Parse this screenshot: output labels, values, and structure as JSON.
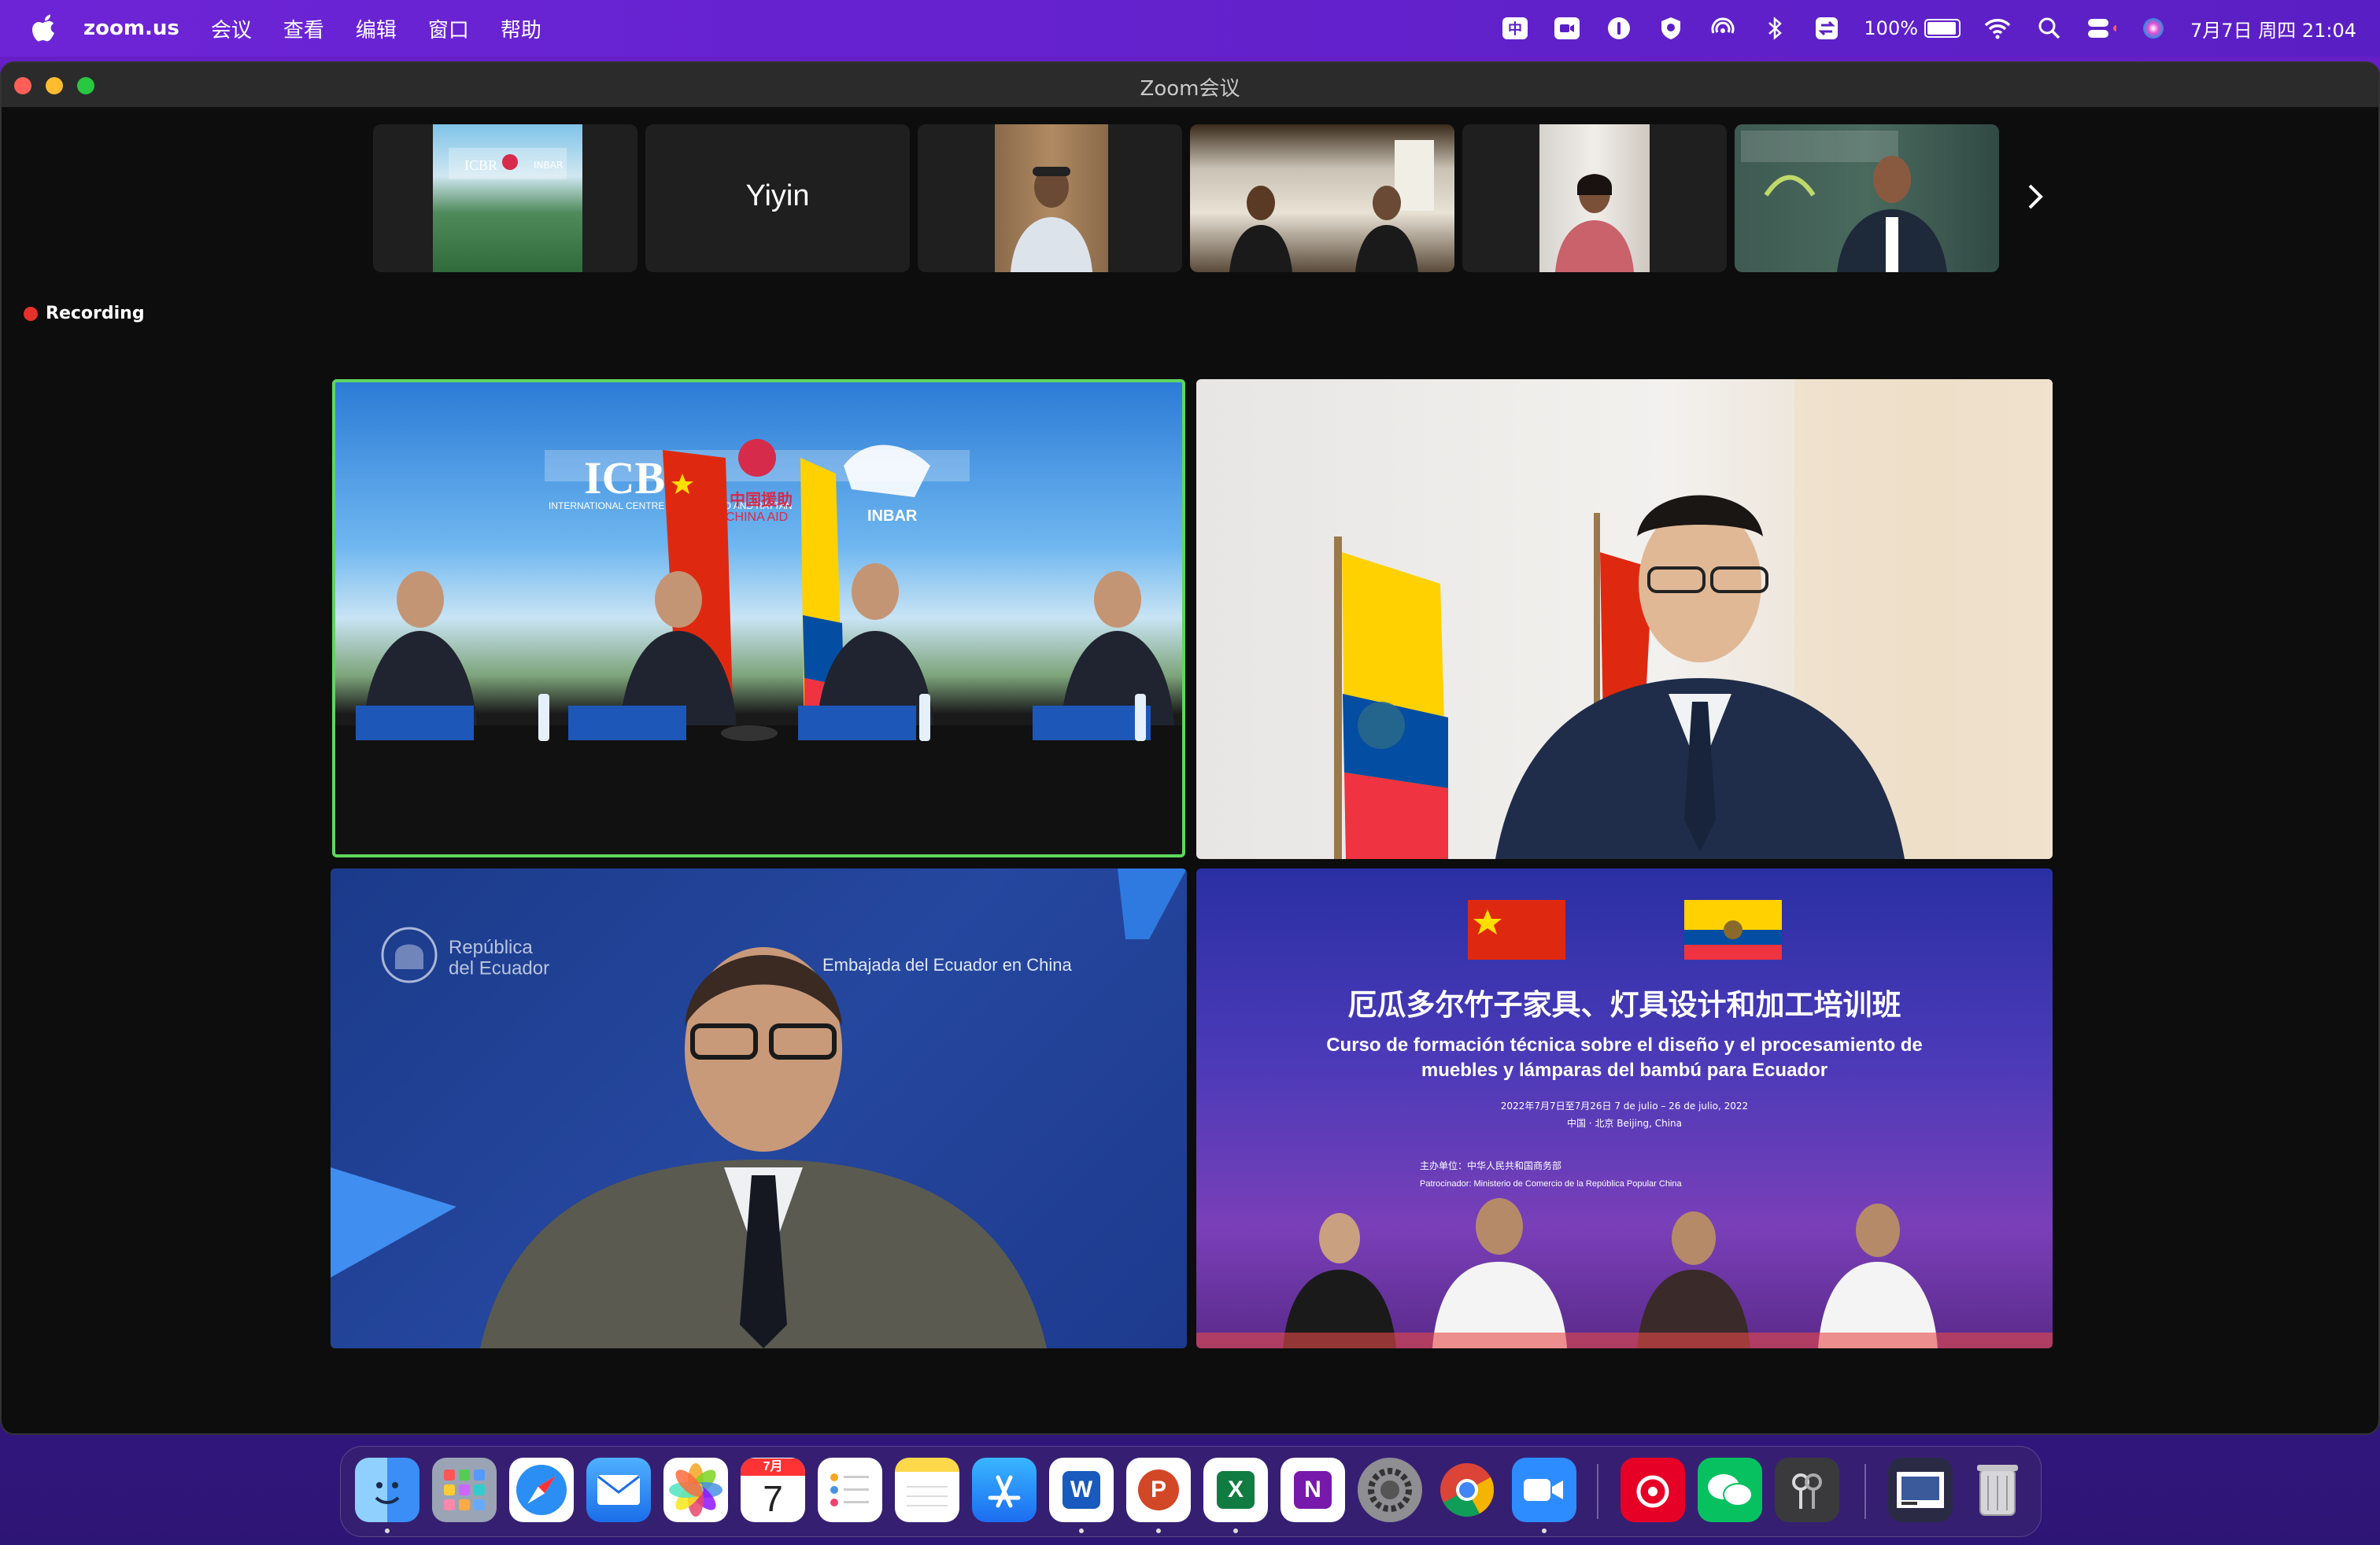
{
  "menubar": {
    "app_name": "zoom.us",
    "menus": [
      "会议",
      "查看",
      "编辑",
      "窗口",
      "帮助"
    ],
    "battery_percent": "100%",
    "battery_level": 1.0,
    "datetime": "7月7日 周四 21:04"
  },
  "window": {
    "title": "Zoom会议"
  },
  "thumbnails": {
    "participant_name": "Yiyin"
  },
  "recording": {
    "label": "Recording"
  },
  "tile1": {
    "logo_text": "ICBR",
    "logo_sub": "INTERNATIONAL CENTRE FOR BAMBOO AND RATTAN",
    "aid_text": "中国援助",
    "aid_en": "CHINA AID",
    "inbar_text": "INBAR"
  },
  "tile3": {
    "republica": "República\ndel Ecuador",
    "embajada": "Embajada del Ecuador en China"
  },
  "tile4": {
    "title_zh": "厄瓜多尔竹子家具、灯具设计和加工培训班",
    "title_es_1": "Curso de formación técnica sobre el diseño y el procesamiento de",
    "title_es_2": "muebles y lámparas del bambú para Ecuador",
    "dates": "2022年7月7日至7月26日   7 de julio – 26 de julio, 2022",
    "place": "中国 · 北京    Beijing, China",
    "host": "主办单位：中华人民共和国商务部",
    "patrocinador": "Patrocinador: Ministerio de Comercio de la República Popular China"
  },
  "colors": {
    "menubar": "#6d24d6",
    "window_bg": "#0d0d0d",
    "active_border": "#5fd65f",
    "recording_dot": "#e5312c"
  },
  "dock": {
    "items": [
      "finder-icon",
      "launchpad-icon",
      "safari-icon",
      "mail-icon",
      "photos-icon",
      "calendar-icon",
      "reminders-icon",
      "notes-icon",
      "app-store-icon",
      "word-icon",
      "powerpoint-icon",
      "excel-icon",
      "onenote-icon",
      "system-settings-icon",
      "chrome-icon",
      "zoom-icon",
      "netease-music-icon",
      "wechat-icon",
      "keychain-icon",
      "screenshot-icon",
      "trash-icon"
    ],
    "calendar_month": "7月",
    "calendar_day": "7",
    "word_letter": "W",
    "powerpoint_letter": "P",
    "excel_letter": "X",
    "onenote_letter": "N"
  }
}
